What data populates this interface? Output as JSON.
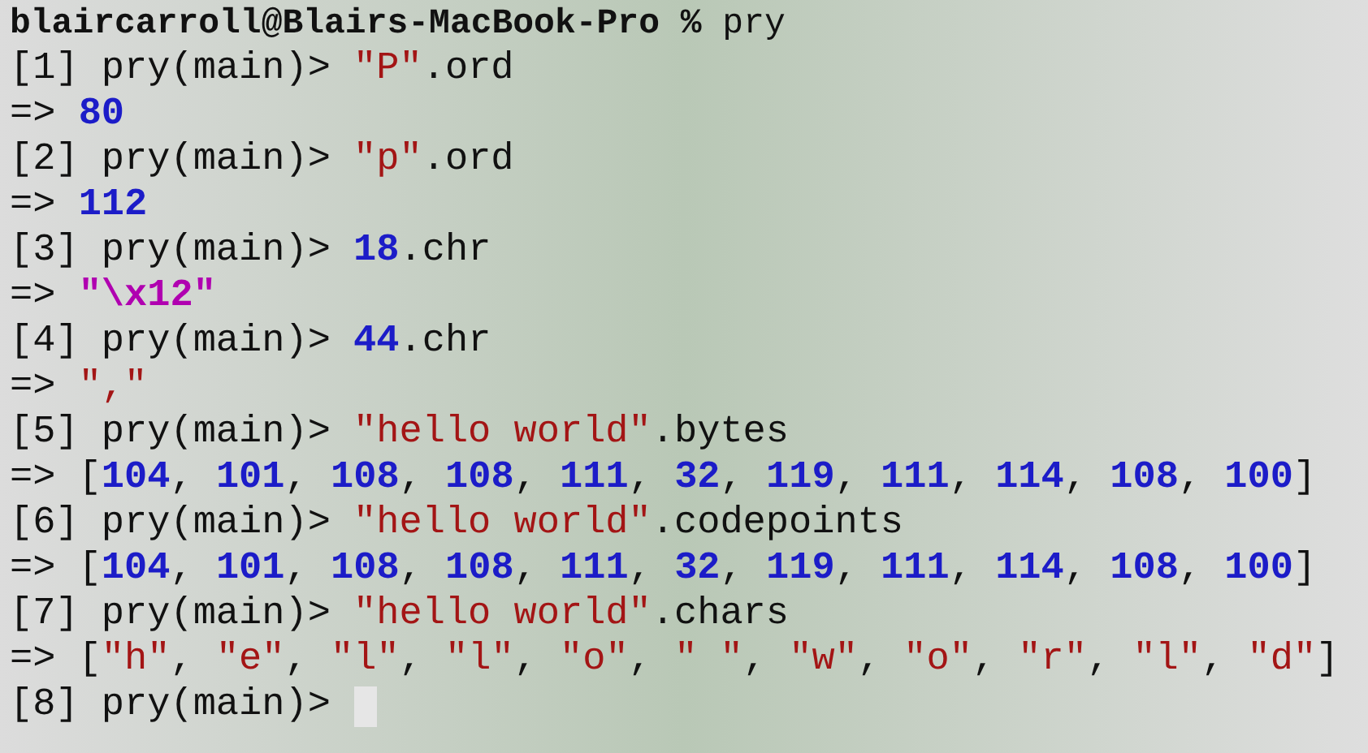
{
  "lines": [
    {
      "cursor": false,
      "segments": [
        {
          "kind": "bold",
          "text": "blaircarroll@Blairs-MacBook-Pro % "
        },
        {
          "kind": "text",
          "text": "pry"
        }
      ]
    },
    {
      "cursor": false,
      "segments": [
        {
          "kind": "text",
          "text": "[1] pry(main)> "
        },
        {
          "kind": "string",
          "text": "\"P\""
        },
        {
          "kind": "text",
          "text": ".ord"
        }
      ]
    },
    {
      "cursor": false,
      "segments": [
        {
          "kind": "text",
          "text": "=> "
        },
        {
          "kind": "number",
          "text": "80"
        }
      ]
    },
    {
      "cursor": false,
      "segments": [
        {
          "kind": "text",
          "text": "[2] pry(main)> "
        },
        {
          "kind": "string",
          "text": "\"p\""
        },
        {
          "kind": "text",
          "text": ".ord"
        }
      ]
    },
    {
      "cursor": false,
      "segments": [
        {
          "kind": "text",
          "text": "=> "
        },
        {
          "kind": "number",
          "text": "112"
        }
      ]
    },
    {
      "cursor": false,
      "segments": [
        {
          "kind": "text",
          "text": "[3] pry(main)> "
        },
        {
          "kind": "number",
          "text": "18"
        },
        {
          "kind": "text",
          "text": ".chr"
        }
      ]
    },
    {
      "cursor": false,
      "segments": [
        {
          "kind": "text",
          "text": "=> "
        },
        {
          "kind": "escape",
          "text": "\"\\x12\""
        }
      ]
    },
    {
      "cursor": false,
      "segments": [
        {
          "kind": "text",
          "text": "[4] pry(main)> "
        },
        {
          "kind": "number",
          "text": "44"
        },
        {
          "kind": "text",
          "text": ".chr"
        }
      ]
    },
    {
      "cursor": false,
      "segments": [
        {
          "kind": "text",
          "text": "=> "
        },
        {
          "kind": "string",
          "text": "\",\""
        }
      ]
    },
    {
      "cursor": false,
      "segments": [
        {
          "kind": "text",
          "text": "[5] pry(main)> "
        },
        {
          "kind": "string",
          "text": "\"hello world\""
        },
        {
          "kind": "text",
          "text": ".bytes"
        }
      ]
    },
    {
      "cursor": false,
      "segments": [
        {
          "kind": "text",
          "text": "=> ["
        },
        {
          "kind": "number",
          "text": "104"
        },
        {
          "kind": "text",
          "text": ", "
        },
        {
          "kind": "number",
          "text": "101"
        },
        {
          "kind": "text",
          "text": ", "
        },
        {
          "kind": "number",
          "text": "108"
        },
        {
          "kind": "text",
          "text": ", "
        },
        {
          "kind": "number",
          "text": "108"
        },
        {
          "kind": "text",
          "text": ", "
        },
        {
          "kind": "number",
          "text": "111"
        },
        {
          "kind": "text",
          "text": ", "
        },
        {
          "kind": "number",
          "text": "32"
        },
        {
          "kind": "text",
          "text": ", "
        },
        {
          "kind": "number",
          "text": "119"
        },
        {
          "kind": "text",
          "text": ", "
        },
        {
          "kind": "number",
          "text": "111"
        },
        {
          "kind": "text",
          "text": ", "
        },
        {
          "kind": "number",
          "text": "114"
        },
        {
          "kind": "text",
          "text": ", "
        },
        {
          "kind": "number",
          "text": "108"
        },
        {
          "kind": "text",
          "text": ", "
        },
        {
          "kind": "number",
          "text": "100"
        },
        {
          "kind": "text",
          "text": "]"
        }
      ]
    },
    {
      "cursor": false,
      "segments": [
        {
          "kind": "text",
          "text": "[6] pry(main)> "
        },
        {
          "kind": "string",
          "text": "\"hello world\""
        },
        {
          "kind": "text",
          "text": ".codepoints"
        }
      ]
    },
    {
      "cursor": false,
      "segments": [
        {
          "kind": "text",
          "text": "=> ["
        },
        {
          "kind": "number",
          "text": "104"
        },
        {
          "kind": "text",
          "text": ", "
        },
        {
          "kind": "number",
          "text": "101"
        },
        {
          "kind": "text",
          "text": ", "
        },
        {
          "kind": "number",
          "text": "108"
        },
        {
          "kind": "text",
          "text": ", "
        },
        {
          "kind": "number",
          "text": "108"
        },
        {
          "kind": "text",
          "text": ", "
        },
        {
          "kind": "number",
          "text": "111"
        },
        {
          "kind": "text",
          "text": ", "
        },
        {
          "kind": "number",
          "text": "32"
        },
        {
          "kind": "text",
          "text": ", "
        },
        {
          "kind": "number",
          "text": "119"
        },
        {
          "kind": "text",
          "text": ", "
        },
        {
          "kind": "number",
          "text": "111"
        },
        {
          "kind": "text",
          "text": ", "
        },
        {
          "kind": "number",
          "text": "114"
        },
        {
          "kind": "text",
          "text": ", "
        },
        {
          "kind": "number",
          "text": "108"
        },
        {
          "kind": "text",
          "text": ", "
        },
        {
          "kind": "number",
          "text": "100"
        },
        {
          "kind": "text",
          "text": "]"
        }
      ]
    },
    {
      "cursor": false,
      "segments": [
        {
          "kind": "text",
          "text": "[7] pry(main)> "
        },
        {
          "kind": "string",
          "text": "\"hello world\""
        },
        {
          "kind": "text",
          "text": ".chars"
        }
      ]
    },
    {
      "cursor": false,
      "segments": [
        {
          "kind": "text",
          "text": "=> ["
        },
        {
          "kind": "string",
          "text": "\"h\""
        },
        {
          "kind": "text",
          "text": ", "
        },
        {
          "kind": "string",
          "text": "\"e\""
        },
        {
          "kind": "text",
          "text": ", "
        },
        {
          "kind": "string",
          "text": "\"l\""
        },
        {
          "kind": "text",
          "text": ", "
        },
        {
          "kind": "string",
          "text": "\"l\""
        },
        {
          "kind": "text",
          "text": ", "
        },
        {
          "kind": "string",
          "text": "\"o\""
        },
        {
          "kind": "text",
          "text": ", "
        },
        {
          "kind": "string",
          "text": "\" \""
        },
        {
          "kind": "text",
          "text": ", "
        },
        {
          "kind": "string",
          "text": "\"w\""
        },
        {
          "kind": "text",
          "text": ", "
        },
        {
          "kind": "string",
          "text": "\"o\""
        },
        {
          "kind": "text",
          "text": ", "
        },
        {
          "kind": "string",
          "text": "\"r\""
        },
        {
          "kind": "text",
          "text": ", "
        },
        {
          "kind": "string",
          "text": "\"l\""
        },
        {
          "kind": "text",
          "text": ", "
        },
        {
          "kind": "string",
          "text": "\"d\""
        },
        {
          "kind": "text",
          "text": "]"
        }
      ]
    },
    {
      "cursor": true,
      "segments": [
        {
          "kind": "text",
          "text": "[8] pry(main)> "
        }
      ]
    }
  ]
}
